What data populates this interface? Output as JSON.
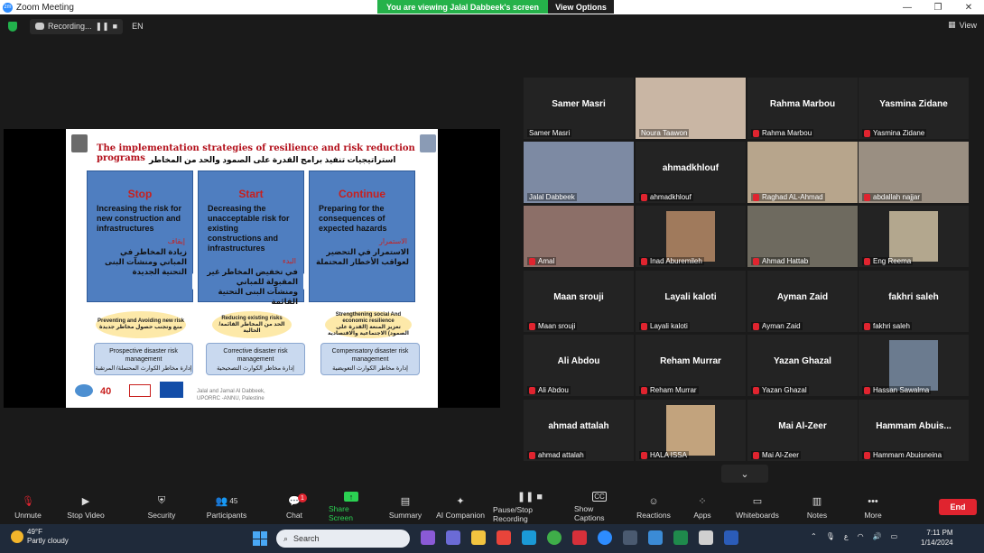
{
  "window": {
    "title": "Zoom Meeting",
    "app_badge": "zm",
    "controls": [
      "—",
      "❐",
      "✕"
    ]
  },
  "banner": {
    "message": "You are viewing Jalal Dabbeek's screen",
    "options_label": "View Options"
  },
  "top_bar": {
    "recording_label": "Recording...",
    "language": "EN",
    "view_label": "View"
  },
  "slide": {
    "title": "The implementation strategies of resilience and risk reduction programs",
    "arabic_title": "استراتيجيات تنفيذ برامج القدرة على الصمود والحد من المخاطر",
    "boxes": [
      {
        "head": "Stop",
        "en": "Increasing the risk for new construction and infrastructures",
        "ar_label": "إيقاف",
        "ar": "زيادة المخاطر في المباني ومنشآت البنى التحتية الجديدة"
      },
      {
        "head": "Start",
        "en": "Decreasing the unacceptable risk for existing constructions and infrastructures",
        "ar_label": "البدء",
        "ar": "في تخفيض المخاطر غير المقبولة للمباني ومنشآت البنى التحتية القائمة"
      },
      {
        "head": "Continue",
        "en": "Preparing for the consequences of expected hazards",
        "ar_label": "الاستمرار",
        "ar": "الاستمرار في التحضير لعواقب الأخطار المحتملة"
      }
    ],
    "ovals": [
      {
        "en": "Preventing and Avoiding new risk",
        "ar": "منع وتجنب حصول مخاطر جديدة"
      },
      {
        "en": "Reducing existing risks",
        "ar": "الحد من المخاطر القائمة/ الحالية"
      },
      {
        "en": "Strengthening social And economic resilience",
        "ar": "تعزيز المنعة (القدرة على الصمود) الاجتماعية والاقتصادية"
      }
    ],
    "management": [
      {
        "en": "Prospective disaster risk management",
        "ar": "إدارة مخاطر الكوارث المحتملة/ المرتقبة"
      },
      {
        "en": "Corrective disaster risk management",
        "ar": "إدارة مخاطر الكوارث التصحيحية"
      },
      {
        "en": "Compensatory disaster risk management",
        "ar": "إدارة مخاطر الكوارث التعويضية"
      }
    ],
    "footer": "Jalal and Jamal Al Dabbeek, UPORRC -ANNU, Palestine",
    "logo_40": "40"
  },
  "participants": [
    {
      "big": "Samer Masri",
      "name": "Samer Masri",
      "muted": false,
      "video": false
    },
    {
      "big": "",
      "name": "Noura Taawon",
      "muted": false,
      "video": true,
      "color": "#c9b6a4"
    },
    {
      "big": "Rahma Marbou",
      "name": "Rahma Marbou",
      "muted": true,
      "video": false
    },
    {
      "big": "Yasmina Zidane",
      "name": "Yasmina Zidane",
      "muted": true,
      "video": false
    },
    {
      "big": "",
      "name": "Jalal Dabbeek",
      "muted": false,
      "video": true,
      "active": true,
      "color": "#7d8aa3"
    },
    {
      "big": "ahmadkhlouf",
      "name": "ahmadkhlouf",
      "muted": true,
      "video": false
    },
    {
      "big": "",
      "name": "Raghad AL-Ahmad",
      "muted": true,
      "video": true,
      "color": "#b7a58c"
    },
    {
      "big": "",
      "name": "abdallah najjar",
      "muted": true,
      "video": true,
      "color": "#9a8f82"
    },
    {
      "big": "",
      "name": "Amal",
      "muted": true,
      "video": true,
      "color": "#8c6f68"
    },
    {
      "big": "",
      "name": "Inad Aburemileh",
      "muted": true,
      "video": true,
      "color": "#a07a5c"
    },
    {
      "big": "",
      "name": "Ahmad Hattab",
      "muted": true,
      "video": true,
      "color": "#6e6a5f"
    },
    {
      "big": "",
      "name": "Eng Reema",
      "muted": true,
      "video": true,
      "color": "#b3a78e"
    },
    {
      "big": "Maan srouji",
      "name": "Maan srouji",
      "muted": true,
      "video": false
    },
    {
      "big": "Layali kaloti",
      "name": "Layali kaloti",
      "muted": true,
      "video": false
    },
    {
      "big": "Ayman Zaid",
      "name": "Ayman Zaid",
      "muted": true,
      "video": false
    },
    {
      "big": "fakhri saleh",
      "name": "fakhri saleh",
      "muted": true,
      "video": false
    },
    {
      "big": "Ali Abdou",
      "name": "Ali Abdou",
      "muted": true,
      "video": false
    },
    {
      "big": "Reham Murrar",
      "name": "Reham Murrar",
      "muted": true,
      "video": false
    },
    {
      "big": "Yazan Ghazal",
      "name": "Yazan Ghazal",
      "muted": true,
      "video": false
    },
    {
      "big": "",
      "name": "Hassan Sawalma",
      "muted": true,
      "video": true,
      "color": "#6b7b8f"
    },
    {
      "big": "ahmad attalah",
      "name": "ahmad attalah",
      "muted": true,
      "video": false
    },
    {
      "big": "",
      "name": "HALA ISSA",
      "muted": true,
      "video": true,
      "color": "#c2a37d"
    },
    {
      "big": "Mai Al-Zeer",
      "name": "Mai Al-Zeer",
      "muted": true,
      "video": false
    },
    {
      "big": "Hammam  Abuis...",
      "name": "Hammam Abuisneina",
      "muted": true,
      "video": false
    }
  ],
  "toolbar": {
    "unmute": "Unmute",
    "stop_video": "Stop Video",
    "security": "Security",
    "participants": "Participants",
    "participants_count": "45",
    "chat": "Chat",
    "chat_badge": "1",
    "share_screen": "Share Screen",
    "summary": "Summary",
    "ai_companion": "AI Companion",
    "pause_recording": "Pause/Stop Recording",
    "show_captions": "Show Captions",
    "reactions": "Reactions",
    "apps": "Apps",
    "whiteboards": "Whiteboards",
    "notes": "Notes",
    "more": "More",
    "end": "End"
  },
  "taskbar": {
    "temperature": "49°F",
    "weather": "Partly cloudy",
    "search_placeholder": "Search",
    "time": "7:11 PM",
    "date": "1/14/2024",
    "lang": "ع"
  }
}
